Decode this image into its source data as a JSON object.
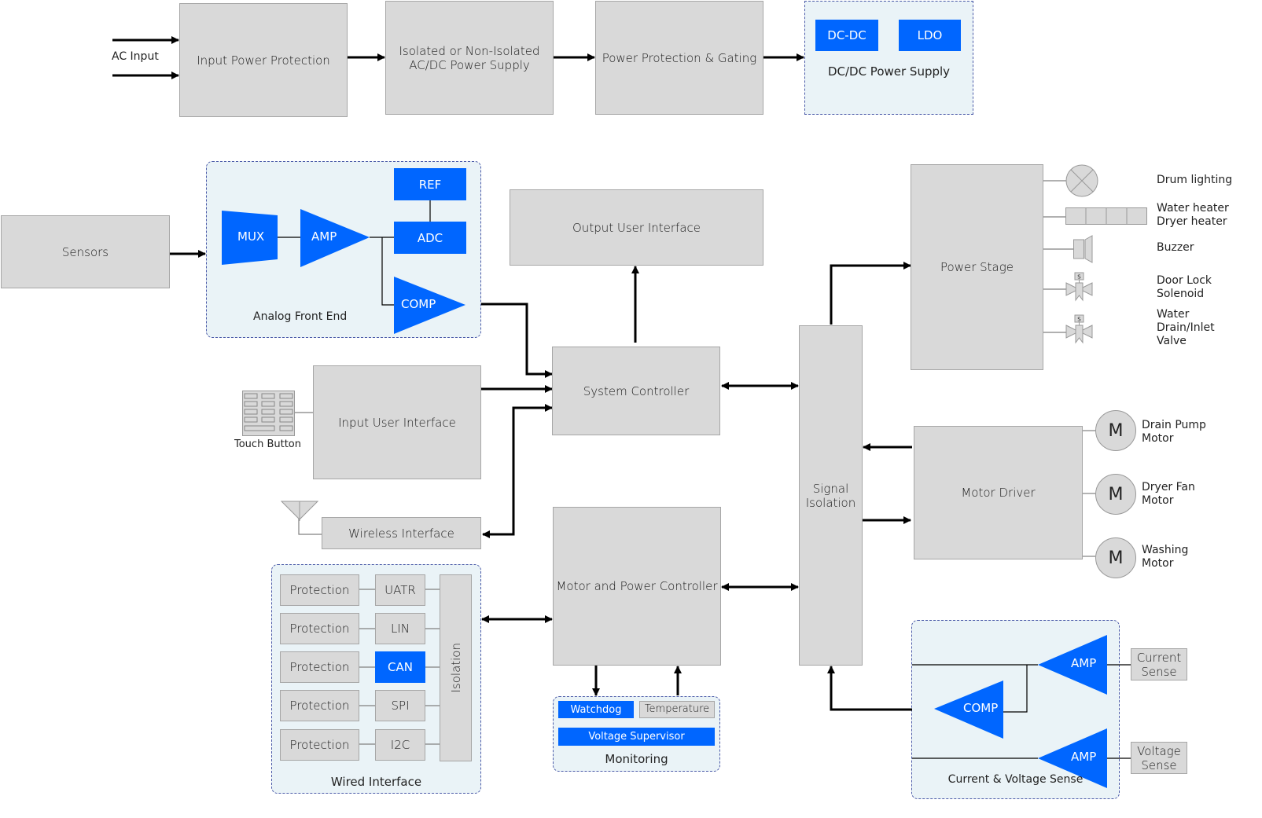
{
  "power_chain": {
    "ac_input_label": "AC Input",
    "input_power_protection": "Input Power Protection",
    "acdc_supply_line1": "Isolated or Non-Isolated",
    "acdc_supply_line2": "AC/DC Power Supply",
    "power_protection_gating": "Power Protection & Gating",
    "dcdc_group": {
      "label": "DC/DC Power Supply",
      "blocks": [
        "DC-DC",
        "LDO"
      ]
    }
  },
  "sensors": "Sensors",
  "analog_front_end": {
    "label": "Analog Front End",
    "mux": "MUX",
    "amp": "AMP",
    "ref": "REF",
    "adc": "ADC",
    "comp": "COMP"
  },
  "output_user_interface": "Output User Interface",
  "system_controller": "System Controller",
  "input_user_interface": "Input User Interface",
  "touch_button_label": "Touch Button",
  "wireless_interface": "Wireless Interface",
  "motor_power_controller": "Motor and Power Controller",
  "signal_isolation_line1": "Signal",
  "signal_isolation_line2": "Isolation",
  "power_stage": "Power Stage",
  "loads": [
    {
      "line1": "Drum lighting",
      "line2": ""
    },
    {
      "line1": "Water heater",
      "line2": "Dryer heater"
    },
    {
      "line1": "Buzzer",
      "line2": ""
    },
    {
      "line1": "Door Lock",
      "line2": "Solenoid"
    },
    {
      "line1": "Water",
      "line2": "Drain/Inlet",
      "line3": "Valve"
    }
  ],
  "solenoid_marker": "S",
  "motor_driver": "Motor Driver",
  "motors": [
    {
      "symbol": "M",
      "line1": "Drain Pump",
      "line2": "Motor"
    },
    {
      "symbol": "M",
      "line1": "Dryer Fan",
      "line2": "Motor"
    },
    {
      "symbol": "M",
      "line1": "Washing",
      "line2": "Motor"
    }
  ],
  "wired_interface": {
    "label": "Wired Interface",
    "protection_label": "Protection",
    "buses": [
      "UATR",
      "LIN",
      "CAN",
      "SPI",
      "I2C"
    ],
    "isolation": "Isolation"
  },
  "monitoring": {
    "label": "Monitoring",
    "watchdog": "Watchdog",
    "temperature": "Temperature",
    "voltage_supervisor": "Voltage Supervisor"
  },
  "current_voltage_sense": {
    "label": "Current & Voltage Sense",
    "amp_top": "AMP",
    "comp": "COMP",
    "amp_bottom": "AMP",
    "current_sense_line1": "Current",
    "current_sense_line2": "Sense",
    "voltage_sense_line1": "Voltage",
    "voltage_sense_line2": "Sense"
  },
  "colors": {
    "block_fill": "#d9d9d9",
    "accent_blue": "#0066ff",
    "group_fill": "#eaf3f7",
    "group_border": "#4b5aa8"
  }
}
